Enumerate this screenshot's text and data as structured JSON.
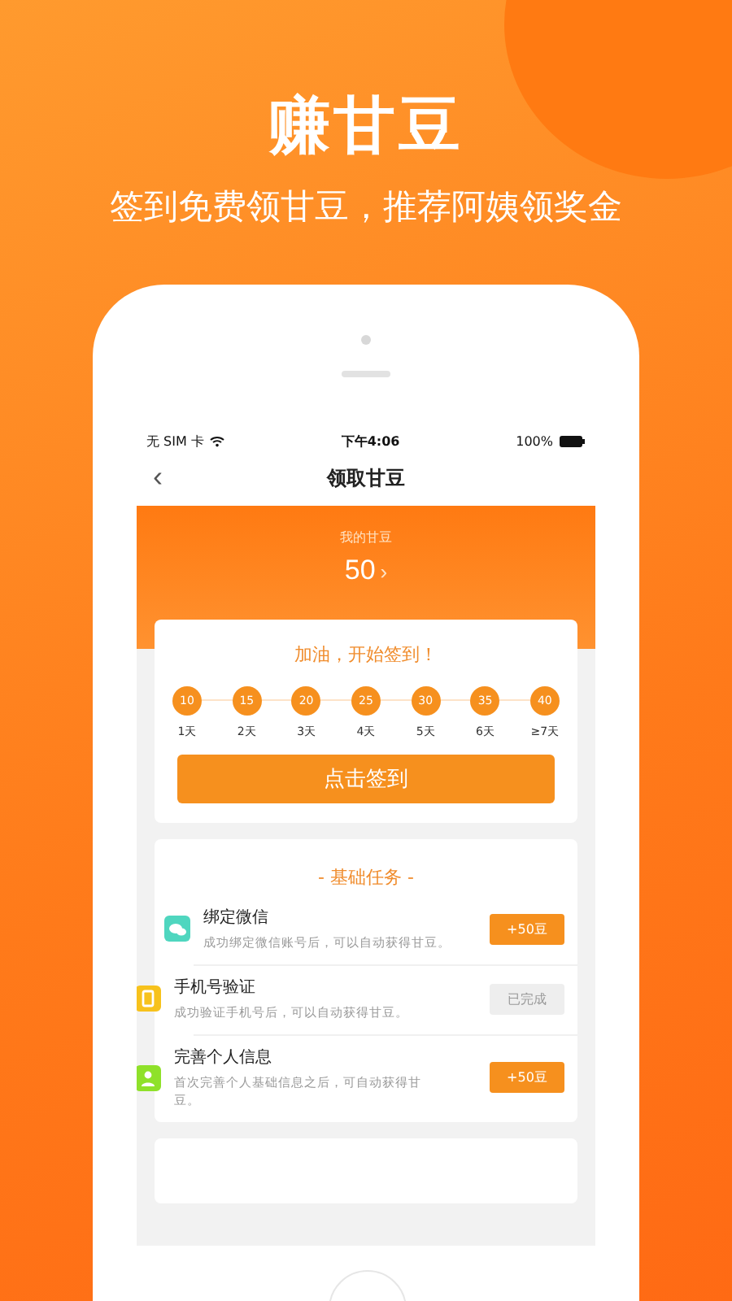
{
  "promo": {
    "headline": "赚甘豆",
    "subtitle": "签到免费领甘豆，推荐阿姨领奖金"
  },
  "status_bar": {
    "carrier": "无 SIM 卡",
    "time": "下午4:06",
    "battery": "100%"
  },
  "nav": {
    "back": "‹",
    "title": "领取甘豆"
  },
  "balance": {
    "label": "我的甘豆",
    "value": "50",
    "arrow": "›"
  },
  "checkin": {
    "title": "加油，开始签到！",
    "days": [
      {
        "points": "10",
        "label": "1天"
      },
      {
        "points": "15",
        "label": "2天"
      },
      {
        "points": "20",
        "label": "3天"
      },
      {
        "points": "25",
        "label": "4天"
      },
      {
        "points": "30",
        "label": "5天"
      },
      {
        "points": "35",
        "label": "6天"
      },
      {
        "points": "40",
        "label": "≥7天"
      }
    ],
    "button": "点击签到"
  },
  "tasks": {
    "title": "- 基础任务 -",
    "items": [
      {
        "kind": "chat",
        "color": "#4fd6bf",
        "title": "绑定微信",
        "description": "成功绑定微信账号后，可以自动获得甘豆。",
        "action": "+50豆",
        "completed": false
      },
      {
        "kind": "phone",
        "color": "#f7c21c",
        "title": "手机号验证",
        "description": "成功验证手机号后，可以自动获得甘豆。",
        "action": "已完成",
        "completed": true
      },
      {
        "kind": "person",
        "color": "#8fe12a",
        "title": "完善个人信息",
        "description": "首次完善个人基础信息之后，可自动获得甘豆。",
        "action": "+50豆",
        "completed": false
      }
    ]
  }
}
